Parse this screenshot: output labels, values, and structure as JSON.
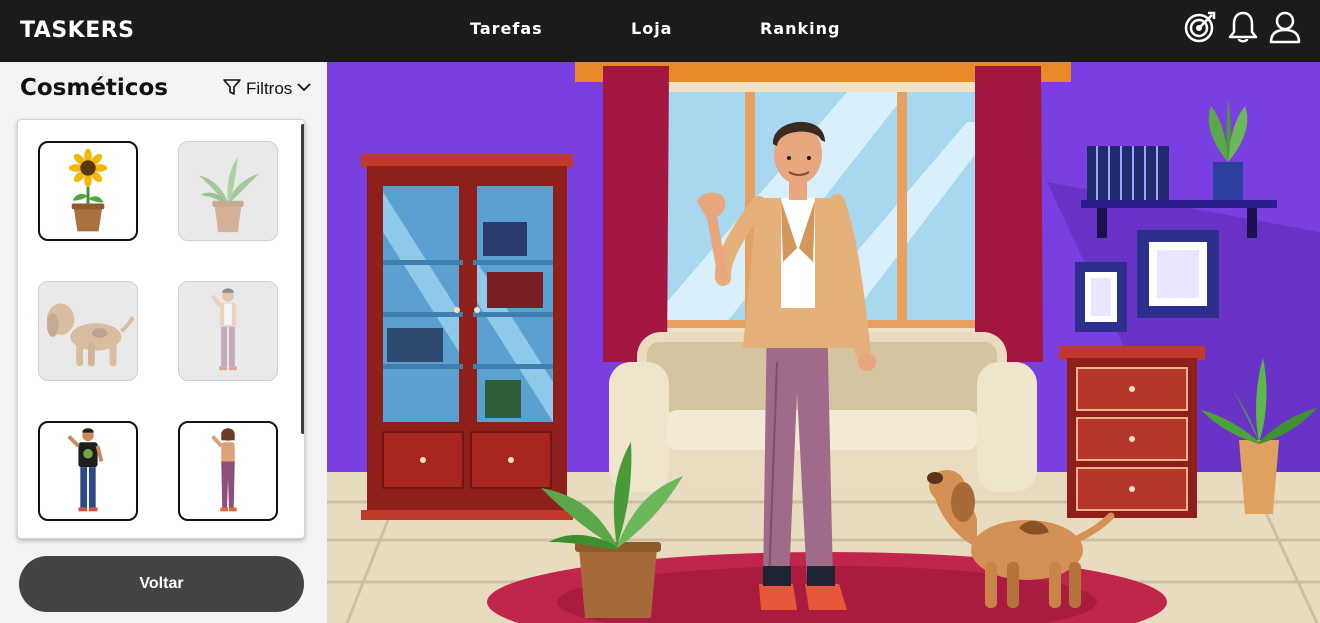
{
  "header": {
    "brand": "TASKERS",
    "nav": [
      {
        "label": "Tarefas"
      },
      {
        "label": "Loja"
      },
      {
        "label": "Ranking"
      }
    ],
    "icons": [
      "target-icon",
      "bell-icon",
      "user-icon"
    ]
  },
  "sidebar": {
    "title": "Cosméticos",
    "filter_label": "Filtros",
    "items": [
      {
        "name": "sunflower",
        "state": "unlocked"
      },
      {
        "name": "plant",
        "state": "locked"
      },
      {
        "name": "dog",
        "state": "locked"
      },
      {
        "name": "man-casual",
        "state": "locked"
      },
      {
        "name": "man-black-tshirt",
        "state": "unlocked"
      },
      {
        "name": "woman-casual",
        "state": "unlocked"
      }
    ],
    "back_label": "Voltar"
  },
  "colors": {
    "header_bg": "#1b1b1b",
    "sidebar_bg": "#f3f3f3",
    "button_bg": "#434343",
    "wall": "#7a3fe0",
    "rug": "#c0254c"
  }
}
